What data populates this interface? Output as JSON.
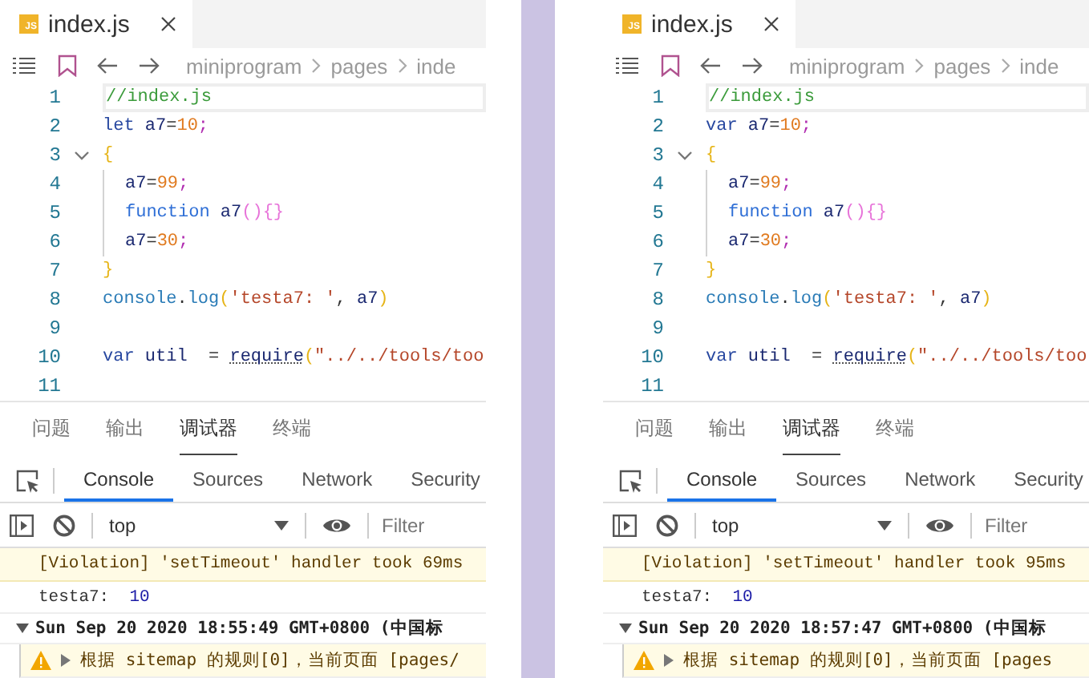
{
  "panels": [
    {
      "editor_tab": {
        "badge": "JS",
        "title": "index.js"
      },
      "breadcrumb": [
        "miniprogram",
        "pages",
        "inde"
      ],
      "code_lines": [
        {
          "number": "1",
          "fold": false,
          "guide": false,
          "current": true,
          "tokens": [
            {
              "kind": "comment",
              "text": "//index.js"
            }
          ]
        },
        {
          "number": "2",
          "fold": false,
          "guide": false,
          "current": false,
          "tokens": [
            {
              "kind": "keyword",
              "text": "let "
            },
            {
              "kind": "ident",
              "text": "a7"
            },
            {
              "kind": "op",
              "text": "="
            },
            {
              "kind": "number",
              "text": "10"
            },
            {
              "kind": "semi",
              "text": ";"
            }
          ]
        },
        {
          "number": "3",
          "fold": true,
          "guide": false,
          "current": false,
          "tokens": [
            {
              "kind": "brace",
              "text": "{"
            }
          ]
        },
        {
          "number": "4",
          "fold": false,
          "guide": true,
          "current": false,
          "tokens": [
            {
              "kind": "ident",
              "text": "a7"
            },
            {
              "kind": "op",
              "text": "="
            },
            {
              "kind": "number",
              "text": "99"
            },
            {
              "kind": "semi",
              "text": ";"
            }
          ]
        },
        {
          "number": "5",
          "fold": false,
          "guide": true,
          "current": false,
          "tokens": [
            {
              "kind": "fnkeyword",
              "text": "function "
            },
            {
              "kind": "ident",
              "text": "a7"
            },
            {
              "kind": "pink",
              "text": "(){}"
            }
          ]
        },
        {
          "number": "6",
          "fold": false,
          "guide": true,
          "current": false,
          "tokens": [
            {
              "kind": "ident",
              "text": "a7"
            },
            {
              "kind": "op",
              "text": "="
            },
            {
              "kind": "number",
              "text": "30"
            },
            {
              "kind": "semi",
              "text": ";"
            }
          ]
        },
        {
          "number": "7",
          "fold": false,
          "guide": false,
          "current": false,
          "tokens": [
            {
              "kind": "brace",
              "text": "}"
            }
          ]
        },
        {
          "number": "8",
          "fold": false,
          "guide": false,
          "current": false,
          "tokens": [
            {
              "kind": "method",
              "text": "console"
            },
            {
              "kind": "op",
              "text": "."
            },
            {
              "kind": "method",
              "text": "log"
            },
            {
              "kind": "brace",
              "text": "("
            },
            {
              "kind": "string",
              "text": "'testa7: '"
            },
            {
              "kind": "op",
              "text": ", "
            },
            {
              "kind": "ident",
              "text": "a7"
            },
            {
              "kind": "brace",
              "text": ")"
            }
          ]
        },
        {
          "number": "9",
          "fold": false,
          "guide": false,
          "current": false
        },
        {
          "number": "10",
          "fold": false,
          "guide": false,
          "current": false,
          "tokens": [
            {
              "kind": "keyword",
              "text": "var "
            },
            {
              "kind": "ident",
              "text": "util"
            },
            {
              "kind": "op",
              "text": "  = "
            },
            {
              "kind": "hint",
              "text": "require"
            },
            {
              "kind": "brace",
              "text": "("
            },
            {
              "kind": "string",
              "text": "\"../../tools/too"
            }
          ]
        },
        {
          "number": "11",
          "fold": false,
          "guide": false,
          "current": false
        }
      ],
      "panel_tabs": [
        {
          "label": "问题",
          "selected": false
        },
        {
          "label": "输出",
          "selected": false
        },
        {
          "label": "调试器",
          "selected": true
        },
        {
          "label": "终端",
          "selected": false
        }
      ],
      "devtools_tabs": [
        {
          "label": "Console",
          "selected": true
        },
        {
          "label": "Sources",
          "selected": false
        },
        {
          "label": "Network",
          "selected": false
        },
        {
          "label": "Security",
          "selected": false
        }
      ],
      "context": "top",
      "filter": {
        "placeholder": "Filter"
      },
      "console": [
        {
          "kind": "violation",
          "text": "[Violation] 'setTimeout' handler took 69ms"
        },
        {
          "kind": "log",
          "label": "testa7:",
          "value": "10"
        },
        {
          "kind": "group",
          "expanded": true,
          "text": "Sun Sep 20 2020 18:55:49 GMT+0800 (中国标"
        },
        {
          "kind": "warning",
          "expanded": false,
          "text": "根据 sitemap 的规则[0]，当前页面 [pages/"
        }
      ]
    },
    {
      "editor_tab": {
        "badge": "JS",
        "title": "index.js"
      },
      "breadcrumb": [
        "miniprogram",
        "pages",
        "inde"
      ],
      "code_lines": [
        {
          "number": "1",
          "fold": false,
          "guide": false,
          "current": true,
          "tokens": [
            {
              "kind": "comment",
              "text": "//index.js"
            }
          ]
        },
        {
          "number": "2",
          "fold": false,
          "guide": false,
          "current": false,
          "tokens": [
            {
              "kind": "keyword",
              "text": "var "
            },
            {
              "kind": "ident",
              "text": "a7"
            },
            {
              "kind": "op",
              "text": "="
            },
            {
              "kind": "number",
              "text": "10"
            },
            {
              "kind": "semi",
              "text": ";"
            }
          ]
        },
        {
          "number": "3",
          "fold": true,
          "guide": false,
          "current": false,
          "tokens": [
            {
              "kind": "brace",
              "text": "{"
            }
          ]
        },
        {
          "number": "4",
          "fold": false,
          "guide": true,
          "current": false,
          "tokens": [
            {
              "kind": "ident",
              "text": "a7"
            },
            {
              "kind": "op",
              "text": "="
            },
            {
              "kind": "number",
              "text": "99"
            },
            {
              "kind": "semi",
              "text": ";"
            }
          ]
        },
        {
          "number": "5",
          "fold": false,
          "guide": true,
          "current": false,
          "tokens": [
            {
              "kind": "fnkeyword",
              "text": "function "
            },
            {
              "kind": "ident",
              "text": "a7"
            },
            {
              "kind": "pink",
              "text": "(){}"
            }
          ]
        },
        {
          "number": "6",
          "fold": false,
          "guide": true,
          "current": false,
          "tokens": [
            {
              "kind": "ident",
              "text": "a7"
            },
            {
              "kind": "op",
              "text": "="
            },
            {
              "kind": "number",
              "text": "30"
            },
            {
              "kind": "semi",
              "text": ";"
            }
          ]
        },
        {
          "number": "7",
          "fold": false,
          "guide": false,
          "current": false,
          "tokens": [
            {
              "kind": "brace",
              "text": "}"
            }
          ]
        },
        {
          "number": "8",
          "fold": false,
          "guide": false,
          "current": false,
          "tokens": [
            {
              "kind": "method",
              "text": "console"
            },
            {
              "kind": "op",
              "text": "."
            },
            {
              "kind": "method",
              "text": "log"
            },
            {
              "kind": "brace",
              "text": "("
            },
            {
              "kind": "string",
              "text": "'testa7: '"
            },
            {
              "kind": "op",
              "text": ", "
            },
            {
              "kind": "ident",
              "text": "a7"
            },
            {
              "kind": "brace",
              "text": ")"
            }
          ]
        },
        {
          "number": "9",
          "fold": false,
          "guide": false,
          "current": false
        },
        {
          "number": "10",
          "fold": false,
          "guide": false,
          "current": false,
          "tokens": [
            {
              "kind": "keyword",
              "text": "var "
            },
            {
              "kind": "ident",
              "text": "util"
            },
            {
              "kind": "op",
              "text": "  = "
            },
            {
              "kind": "hint",
              "text": "require"
            },
            {
              "kind": "brace",
              "text": "("
            },
            {
              "kind": "string",
              "text": "\"../../tools/too"
            }
          ]
        },
        {
          "number": "11",
          "fold": false,
          "guide": false,
          "current": false
        }
      ],
      "panel_tabs": [
        {
          "label": "问题",
          "selected": false
        },
        {
          "label": "输出",
          "selected": false
        },
        {
          "label": "调试器",
          "selected": true
        },
        {
          "label": "终端",
          "selected": false
        }
      ],
      "devtools_tabs": [
        {
          "label": "Console",
          "selected": true
        },
        {
          "label": "Sources",
          "selected": false
        },
        {
          "label": "Network",
          "selected": false
        },
        {
          "label": "Security",
          "selected": false
        }
      ],
      "context": "top",
      "filter": {
        "placeholder": "Filter"
      },
      "console": [
        {
          "kind": "violation",
          "text": "[Violation] 'setTimeout' handler took 95ms"
        },
        {
          "kind": "log",
          "label": "testa7:",
          "value": "10"
        },
        {
          "kind": "group",
          "expanded": true,
          "text": "Sun Sep 20 2020 18:57:47 GMT+0800 (中国标"
        },
        {
          "kind": "warning",
          "expanded": false,
          "text": "根据 sitemap 的规则[0]，当前页面 [pages"
        }
      ]
    }
  ]
}
